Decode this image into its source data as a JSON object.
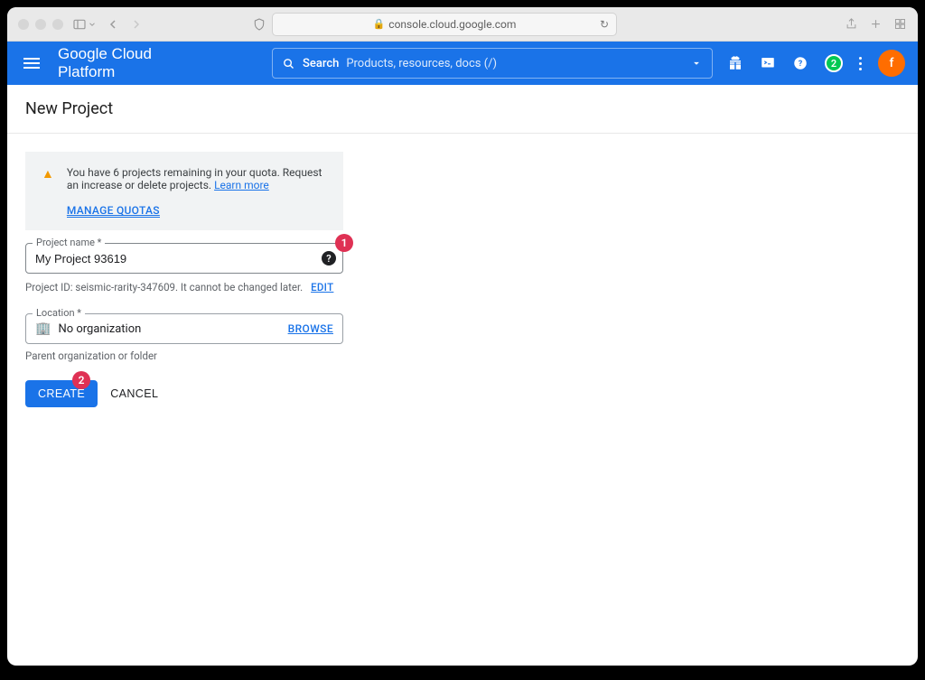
{
  "browser": {
    "url_display": "console.cloud.google.com"
  },
  "header": {
    "platform_title": "Google Cloud Platform",
    "search_label": "Search",
    "search_placeholder": "Products, resources, docs (/)",
    "notif_count": "2",
    "avatar_letter": "f"
  },
  "page": {
    "title": "New Project",
    "quota": {
      "message": "You have 6 projects remaining in your quota. Request an increase or delete projects. ",
      "learn_more": "Learn more",
      "manage": "MANAGE QUOTAS"
    },
    "project_name": {
      "label": "Project name *",
      "value": "My Project 93619",
      "id_text": "Project ID: seismic-rarity-347609. It cannot be changed later.",
      "edit": "EDIT"
    },
    "location": {
      "label": "Location *",
      "value": "No organization",
      "browse": "BROWSE",
      "hint": "Parent organization or folder"
    },
    "actions": {
      "create": "CREATE",
      "cancel": "CANCEL"
    },
    "annotations": {
      "one": "1",
      "two": "2"
    }
  }
}
